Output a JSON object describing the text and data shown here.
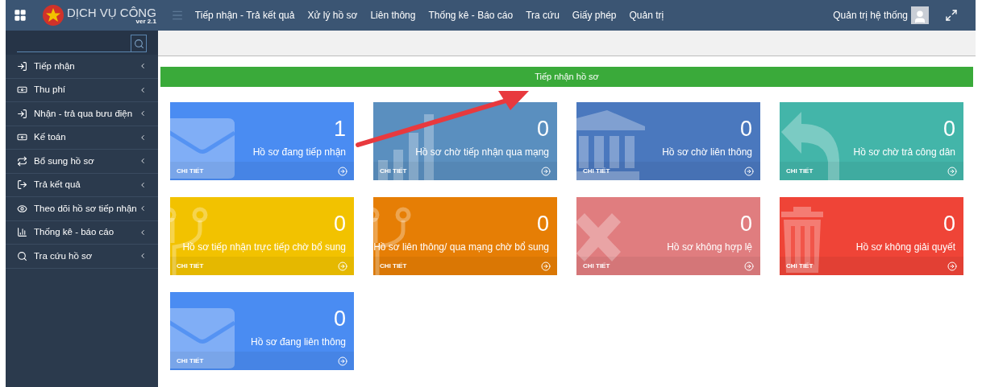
{
  "header": {
    "logo_title": "DỊCH VỤ CÔNG",
    "logo_version": "ver 2.1",
    "menu": [
      "Tiếp nhận - Trả kết quả",
      "Xử lý hồ sơ",
      "Liên thông",
      "Thống kê - Báo cáo",
      "Tra cứu",
      "Giấy phép",
      "Quản trị"
    ],
    "user": "Quản trị hệ thống"
  },
  "sidebar": {
    "items": [
      {
        "label": "Tiếp nhận"
      },
      {
        "label": "Thu phí"
      },
      {
        "label": "Nhận - trả qua bưu điện"
      },
      {
        "label": "Kế toán"
      },
      {
        "label": "Bổ sung hồ sơ"
      },
      {
        "label": "Trả kết quả"
      },
      {
        "label": "Theo dõi hồ sơ tiếp nhận"
      },
      {
        "label": "Thống kê - báo cáo"
      },
      {
        "label": "Tra cứu hồ sơ"
      }
    ]
  },
  "section_title": "Tiếp nhận hồ sơ",
  "cards": [
    {
      "kind": "envelope",
      "color": "#4a8cf2",
      "count": "1",
      "label": "Hồ sơ đang tiếp nhận",
      "link": "CHI TIẾT"
    },
    {
      "kind": "bars",
      "color": "#5a8fbf",
      "count": "0",
      "label": "Hồ sơ chờ tiếp nhận qua mạng",
      "link": "CHI TIẾT"
    },
    {
      "kind": "bank",
      "color": "#4a78be",
      "count": "0",
      "label": "Hồ sơ chờ liên thông",
      "link": "CHI TIẾT"
    },
    {
      "kind": "reply",
      "color": "#43b5a9",
      "count": "0",
      "label": "Hồ sơ chờ trả công dân",
      "link": "CHI TIẾT"
    },
    {
      "kind": "branch",
      "color": "#f2c200",
      "count": "0",
      "label": "Hồ sơ tiếp nhận trực tiếp chờ bổ sung",
      "link": "CHI TIẾT"
    },
    {
      "kind": "branch",
      "color": "#e67e05",
      "count": "0",
      "label": "Hồ sơ liên thông/ qua mạng chờ bổ sung",
      "link": "CHI TIẾT"
    },
    {
      "kind": "cross",
      "color": "#e07d7f",
      "count": "0",
      "label": "Hồ sơ không hợp lệ",
      "link": "CHI TIẾT"
    },
    {
      "kind": "trash",
      "color": "#ef4437",
      "count": "0",
      "label": "Hồ sơ không giải quyết",
      "link": "CHI TIẾT"
    },
    {
      "kind": "envelope",
      "color": "#4a8cf2",
      "count": "0",
      "label": "Hồ sơ đang liên thông",
      "link": "CHI TIẾT"
    }
  ]
}
